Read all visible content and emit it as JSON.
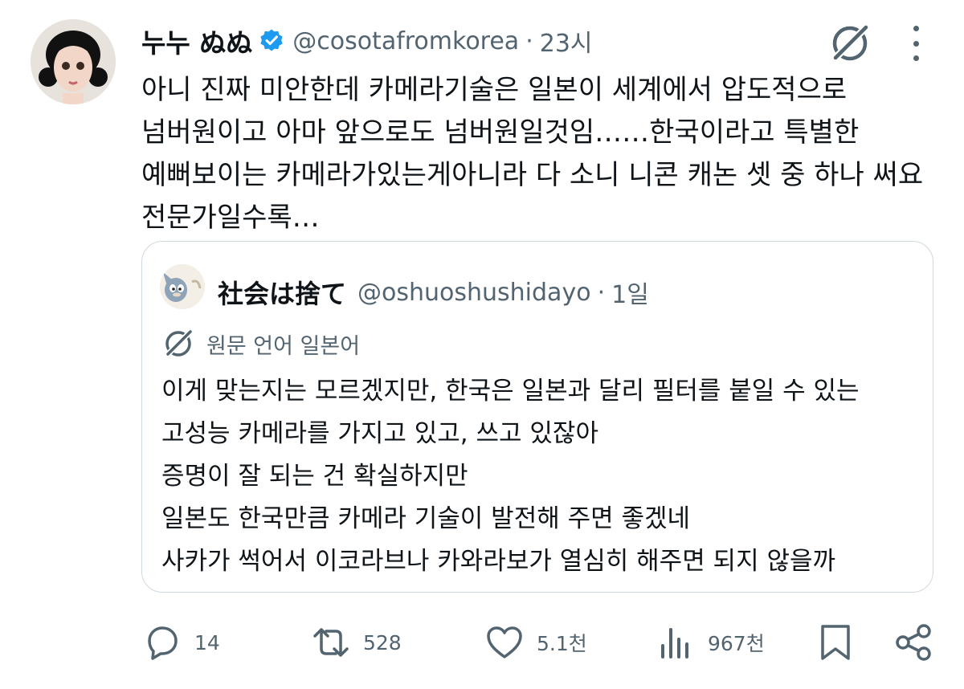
{
  "tweet": {
    "author_name": "누누 ぬぬ",
    "handle": "@cosotafromkorea",
    "separator": "·",
    "time": "23시",
    "lines": [
      "아니 진짜 미안한데 카메라기술은 일본이 세계에서 압도적으로",
      "넘버원이고 아마 앞으로도 넘버원일것임……한국이라고 특별한",
      "예뻐보이는 카메라가있는게아니라 다 소니 니콘 캐논 셋 중 하나 써요",
      "전문가일수록…"
    ]
  },
  "quote": {
    "author_name": "社会は捨て",
    "handle": "@oshuoshushidayo",
    "separator": "·",
    "time": "1일",
    "translate_label": "원문 언어 일본어",
    "lines": [
      "이게 맞는지는 모르겠지만, 한국은 일본과 달리 필터를 붙일 수 있는",
      "고성능 카메라를 가지고 있고, 쓰고 있잖아",
      "증명이 잘 되는 건 확실하지만",
      "일본도 한국만큼 카메라 기술이 발전해 주면 좋겠네",
      "사카가 썩어서 이코라브나 카와라보가 열심히 해주면 되지 않을까"
    ]
  },
  "actions": {
    "replies": "14",
    "reposts": "528",
    "likes": "5.1천",
    "views": "967천"
  },
  "colors": {
    "verified": "#1d9bf0",
    "secondary_text": "#536471",
    "border": "#cfd9de"
  },
  "icons": [
    "verified-badge-icon",
    "grok-icon",
    "more-icon",
    "translate-icon",
    "reply-icon",
    "repost-icon",
    "like-icon",
    "views-icon",
    "bookmark-icon",
    "share-icon"
  ]
}
